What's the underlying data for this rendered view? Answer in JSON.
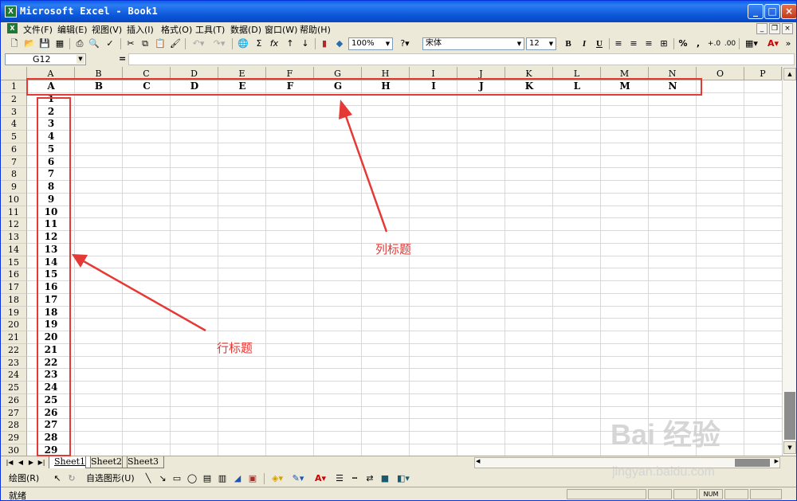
{
  "window": {
    "title": "Microsoft Excel - Book1"
  },
  "title_buttons": {
    "minimize": "_",
    "maximize": "□",
    "close": "×"
  },
  "menubar": {
    "items": [
      "文件(F)",
      "编辑(E)",
      "视图(V)",
      "插入(I)",
      "格式(O)",
      "工具(T)",
      "数据(D)",
      "窗口(W)",
      "帮助(H)"
    ]
  },
  "toolbar": {
    "zoom": "100%",
    "font_name": "宋体",
    "font_size": "12",
    "bold": "B",
    "italic": "I",
    "underline": "U",
    "percent": "%",
    "comma": ","
  },
  "formula_bar": {
    "cell_ref": "G12",
    "equals": "=",
    "content": ""
  },
  "columns": [
    "A",
    "B",
    "C",
    "D",
    "E",
    "F",
    "G",
    "H",
    "I",
    "J",
    "K",
    "L",
    "M",
    "N",
    "O",
    "P"
  ],
  "rows": [
    "1",
    "2",
    "3",
    "4",
    "5",
    "6",
    "7",
    "8",
    "9",
    "10",
    "11",
    "12",
    "13",
    "14",
    "15",
    "16",
    "17",
    "18",
    "19",
    "20",
    "21",
    "22",
    "23",
    "24",
    "25",
    "26",
    "27",
    "28",
    "29",
    "30"
  ],
  "row1_values": [
    "A",
    "B",
    "C",
    "D",
    "E",
    "F",
    "G",
    "H",
    "I",
    "J",
    "K",
    "L",
    "M",
    "N"
  ],
  "colA_values": [
    "1",
    "2",
    "3",
    "4",
    "5",
    "6",
    "7",
    "8",
    "9",
    "10",
    "11",
    "12",
    "13",
    "14",
    "15",
    "16",
    "17",
    "18",
    "19",
    "20",
    "21",
    "22",
    "23",
    "24",
    "25",
    "26",
    "27",
    "28",
    "29"
  ],
  "sheets": [
    "Sheet1",
    "Sheet2",
    "Sheet3"
  ],
  "drawing_toolbar": {
    "draw": "绘图(R)",
    "autoshapes": "自选图形(U)"
  },
  "status": {
    "text": "就绪",
    "num": "NUM"
  },
  "annotations": {
    "column_heading": "列标题",
    "row_heading": "行标题"
  },
  "watermark": {
    "brand": "Bai  经验",
    "url": "jingyan.baidu.com"
  },
  "colors": {
    "title_bar": "#0a5fe8",
    "chrome": "#ece9d8",
    "annotation": "#e53935",
    "excel_green": "#1d7a34"
  }
}
